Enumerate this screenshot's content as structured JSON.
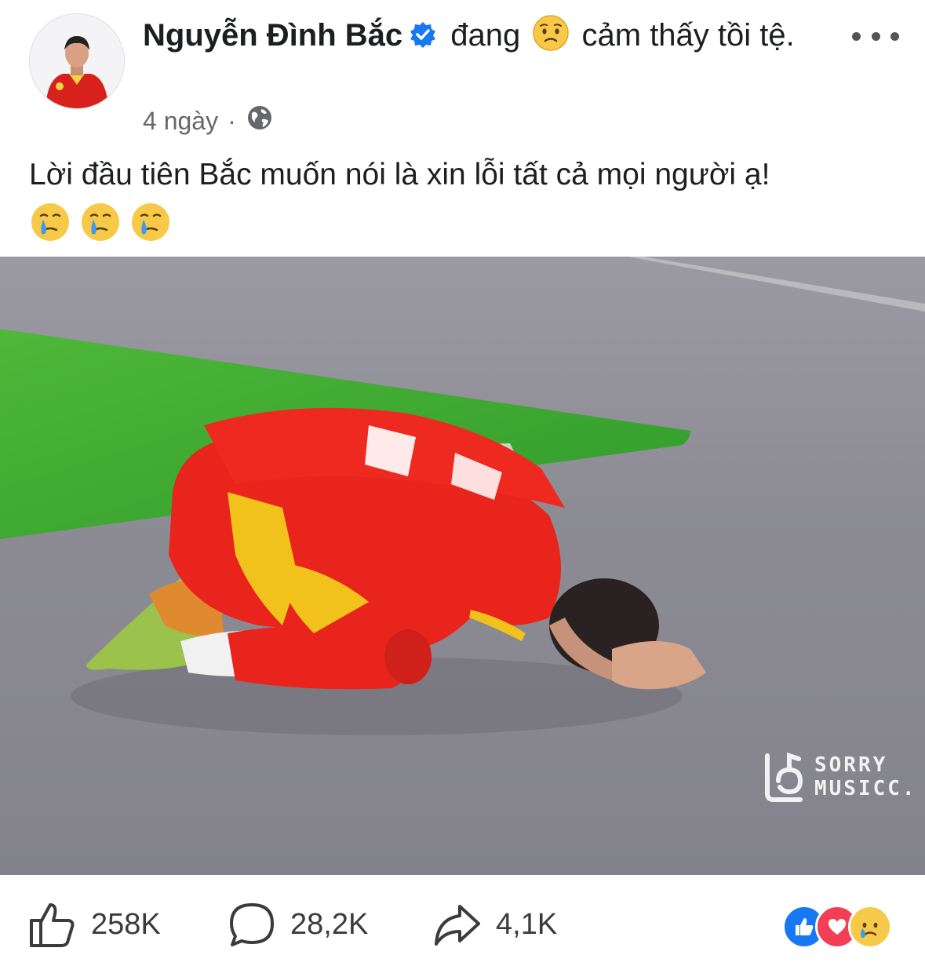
{
  "post": {
    "author": "Nguyễn Đình Bắc",
    "verified": true,
    "feeling_prefix": "đang",
    "feeling_emoji": "sad-face-emoji",
    "feeling_text": "cảm thấy tồi tệ.",
    "time": "4 ngày",
    "separator": "·",
    "audience_icon": "globe-icon",
    "message": "Lời đầu tiên Bắc muốn nói là xin lỗi tất cả mọi người ạ!",
    "message_emojis": [
      "crying-face-emoji",
      "crying-face-emoji",
      "crying-face-emoji"
    ]
  },
  "photo": {
    "watermark_line1": "SORRY",
    "watermark_line2": "MUSICC."
  },
  "actions": {
    "likes": "258K",
    "comments": "28,2K",
    "shares": "4,1K"
  },
  "reactions": [
    "like-reaction-icon",
    "love-reaction-icon",
    "sad-reaction-icon"
  ],
  "colors": {
    "verified_blue": "#1877f2",
    "text": "#1c1e21",
    "secondary_text": "#65676b",
    "jersey_red": "#e8241c",
    "pitch_green": "#35a02c"
  }
}
